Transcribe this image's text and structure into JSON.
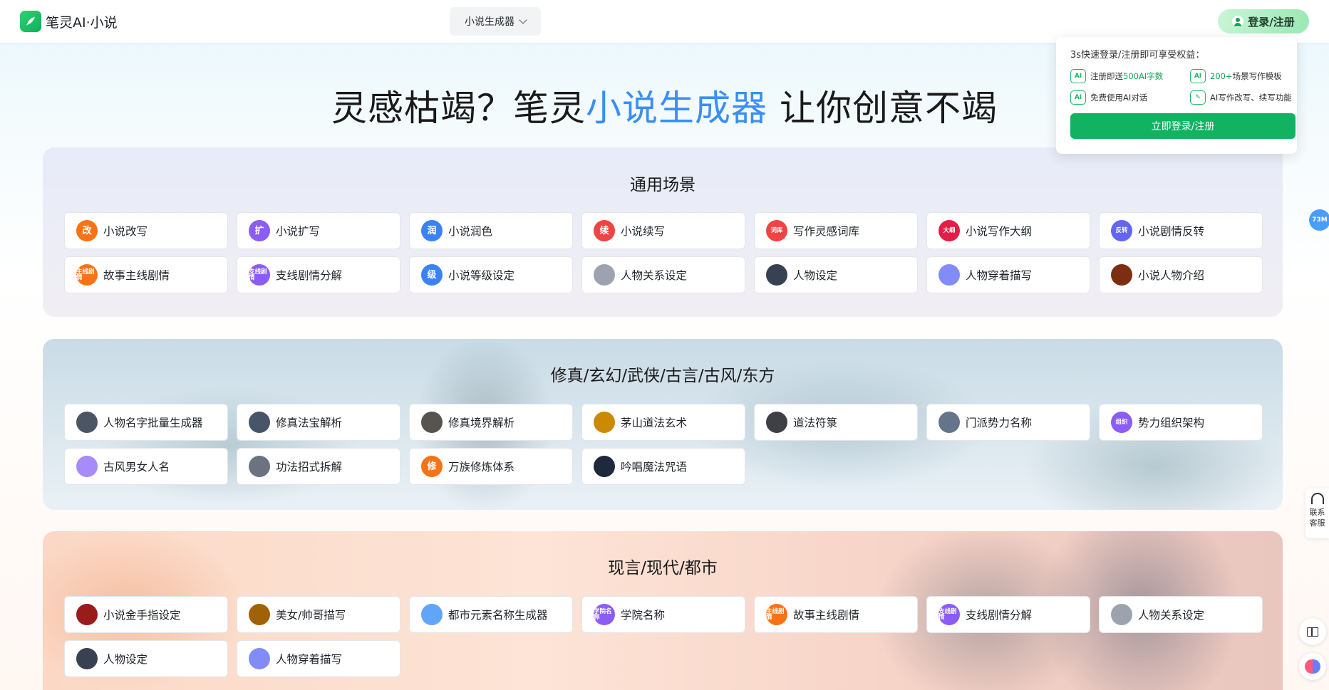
{
  "header": {
    "logo_text": "笔灵AI·小说",
    "tool_select": "小说生成器",
    "login_label": "登录/注册"
  },
  "popup": {
    "title": "3s快速登录/注册即可享受权益：",
    "perks": [
      {
        "icon": "AI",
        "prefix": "注册即送",
        "highlight": "500AI字数",
        "suffix": ""
      },
      {
        "icon": "AI",
        "prefix": "",
        "highlight": "200+",
        "suffix": "场景写作模板"
      },
      {
        "icon": "AI",
        "prefix": "免费使用AI对话",
        "highlight": "",
        "suffix": ""
      },
      {
        "icon": "✎",
        "prefix": "AI写作改写、续写功能",
        "highlight": "",
        "suffix": ""
      }
    ],
    "button": "立即登录/注册"
  },
  "hero": {
    "part1": "灵感枯竭？笔灵",
    "accent": "小说生成器",
    "part2": " 让你创意不竭"
  },
  "sections": [
    {
      "title": "通用场景",
      "items": [
        {
          "label": "小说改写",
          "icon_text": "改",
          "color": "#f97316"
        },
        {
          "label": "小说扩写",
          "icon_text": "扩",
          "color": "#8b5cf6"
        },
        {
          "label": "小说润色",
          "icon_text": "润",
          "color": "#3b82f6"
        },
        {
          "label": "小说续写",
          "icon_text": "续",
          "color": "#ef4444"
        },
        {
          "label": "写作灵感词库",
          "icon_text": "词库",
          "color": "#ef4444"
        },
        {
          "label": "小说写作大纲",
          "icon_text": "大纲",
          "color": "#e11d48"
        },
        {
          "label": "小说剧情反转",
          "icon_text": "反转",
          "color": "#6366f1"
        },
        {
          "label": "故事主线剧情",
          "icon_text": "主线剧情",
          "color": "#f97316"
        },
        {
          "label": "支线剧情分解",
          "icon_text": "支线剧情",
          "color": "#8b5cf6"
        },
        {
          "label": "小说等级设定",
          "icon_text": "级",
          "color": "#3b82f6"
        },
        {
          "label": "人物关系设定",
          "icon_text": "",
          "color": "#9ca3af"
        },
        {
          "label": "人物设定",
          "icon_text": "",
          "color": "#374151"
        },
        {
          "label": "人物穿着描写",
          "icon_text": "",
          "color": "#818cf8"
        },
        {
          "label": "小说人物介绍",
          "icon_text": "",
          "color": "#7c2d12"
        }
      ]
    },
    {
      "title": "修真/玄幻/武侠/古言/古风/东方",
      "items": [
        {
          "label": "人物名字批量生成器",
          "icon_text": "",
          "color": "#4b5563"
        },
        {
          "label": "修真法宝解析",
          "icon_text": "",
          "color": "#475569"
        },
        {
          "label": "修真境界解析",
          "icon_text": "",
          "color": "#57534e"
        },
        {
          "label": "茅山道法玄术",
          "icon_text": "",
          "color": "#ca8a04"
        },
        {
          "label": "道法符箓",
          "icon_text": "",
          "color": "#3f3f46"
        },
        {
          "label": "门派势力名称",
          "icon_text": "",
          "color": "#64748b"
        },
        {
          "label": "势力组织架构",
          "icon_text": "组织",
          "color": "#8b5cf6"
        },
        {
          "label": "古风男女人名",
          "icon_text": "",
          "color": "#a78bfa"
        },
        {
          "label": "功法招式拆解",
          "icon_text": "",
          "color": "#6b7280"
        },
        {
          "label": "万族修炼体系",
          "icon_text": "修",
          "color": "#f97316"
        },
        {
          "label": "吟唱魔法咒语",
          "icon_text": "",
          "color": "#1e293b"
        }
      ]
    },
    {
      "title": "现言/现代/都市",
      "items": [
        {
          "label": "小说金手指设定",
          "icon_text": "",
          "color": "#991b1b"
        },
        {
          "label": "美女/帅哥描写",
          "icon_text": "",
          "color": "#a16207"
        },
        {
          "label": "都市元素名称生成器",
          "icon_text": "",
          "color": "#60a5fa"
        },
        {
          "label": "学院名称",
          "icon_text": "学院名称",
          "color": "#8b5cf6"
        },
        {
          "label": "故事主线剧情",
          "icon_text": "主线剧情",
          "color": "#f97316"
        },
        {
          "label": "支线剧情分解",
          "icon_text": "支线剧情",
          "color": "#8b5cf6"
        },
        {
          "label": "人物关系设定",
          "icon_text": "",
          "color": "#9ca3af"
        },
        {
          "label": "人物设定",
          "icon_text": "",
          "color": "#374151"
        },
        {
          "label": "人物穿着描写",
          "icon_text": "",
          "color": "#818cf8"
        }
      ]
    }
  ],
  "rail": {
    "badge": "73M",
    "service_label": "联系客服"
  }
}
